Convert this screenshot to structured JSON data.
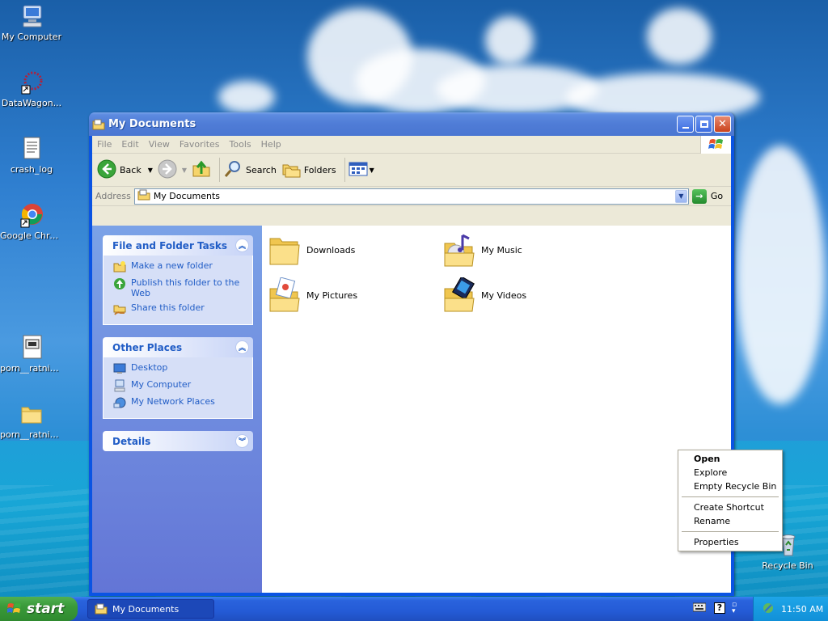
{
  "desktop": {
    "icons": [
      {
        "label": "My Computer"
      },
      {
        "label": "DataWagon..."
      },
      {
        "label": "crash_log"
      },
      {
        "label": "Google Chrome"
      },
      {
        "label": "porn__ratnik..."
      },
      {
        "label": "porn__ratnik..."
      },
      {
        "label": "Recycle Bin"
      }
    ]
  },
  "window": {
    "title": "My Documents",
    "menu": [
      "File",
      "Edit",
      "View",
      "Favorites",
      "Tools",
      "Help"
    ],
    "toolbar": {
      "back": "Back",
      "search": "Search",
      "folders": "Folders"
    },
    "address": {
      "label": "Address",
      "value": "My Documents",
      "go": "Go"
    },
    "tasks": {
      "file_folder": {
        "title": "File and Folder Tasks",
        "items": [
          "Make a new folder",
          "Publish this folder to the Web",
          "Share this folder"
        ]
      },
      "other_places": {
        "title": "Other Places",
        "items": [
          "Desktop",
          "My Computer",
          "My Network Places"
        ]
      },
      "details": {
        "title": "Details"
      }
    },
    "files": [
      {
        "name": "Downloads"
      },
      {
        "name": "My Music"
      },
      {
        "name": "My Pictures"
      },
      {
        "name": "My Videos"
      }
    ]
  },
  "context_menu": {
    "items": [
      "Open",
      "Explore",
      "Empty Recycle Bin",
      "Create Shortcut",
      "Rename",
      "Properties"
    ]
  },
  "taskbar": {
    "start": "start",
    "task": "My Documents",
    "clock": "11:50 AM"
  },
  "colors": {
    "xp_blue": "#0a54e3",
    "task_link": "#215dc6",
    "start_green": "#3a9a3a"
  }
}
